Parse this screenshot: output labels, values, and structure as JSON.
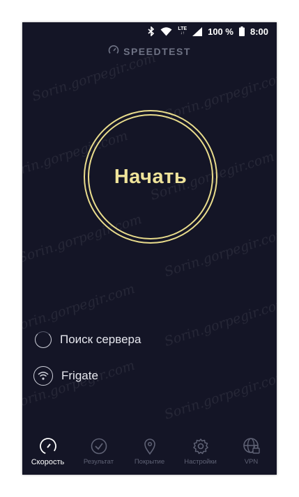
{
  "status_bar": {
    "network_type": "LTE",
    "battery_percent": "100 %",
    "time": "8:00",
    "icons": [
      "bluetooth-icon",
      "wifi-icon",
      "cellular-signal-icon",
      "battery-icon"
    ]
  },
  "header": {
    "brand": "SPEEDTEST",
    "icon": "gauge-icon"
  },
  "main": {
    "start_button_label": "Начать"
  },
  "info": {
    "server_status": "Поиск сервера",
    "network_name": "Frigate"
  },
  "tabs": [
    {
      "label": "Скорость",
      "icon": "speedometer-icon",
      "active": true
    },
    {
      "label": "Результат",
      "icon": "checkmark-circle-icon",
      "active": false
    },
    {
      "label": "Покрытие",
      "icon": "map-pin-icon",
      "active": false
    },
    {
      "label": "Настройки",
      "icon": "gear-icon",
      "active": false
    },
    {
      "label": "VPN",
      "icon": "globe-lock-icon",
      "active": false
    }
  ],
  "watermark": "Sorin.gorpegir.com",
  "colors": {
    "background": "#141526",
    "accent": "#e9dc8c",
    "text": "#e6e7ee",
    "muted": "#5f6275"
  }
}
